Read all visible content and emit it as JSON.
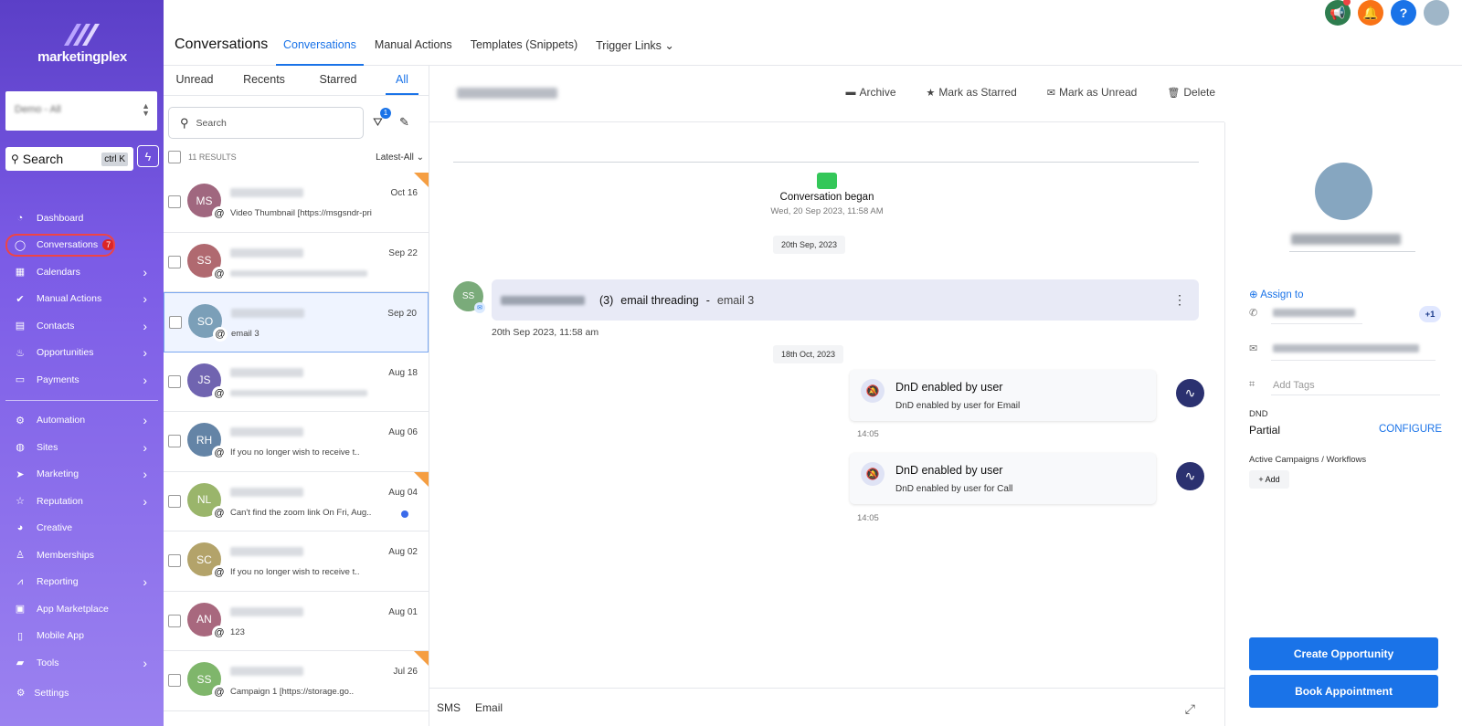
{
  "brand": {
    "name": "marketingplex"
  },
  "sidebar": {
    "account": "Demo - All",
    "search_label": "Search",
    "search_shortcut": "ctrl K",
    "items": [
      {
        "label": "Dashboard",
        "icon": "dashboard-icon",
        "arrow": false
      },
      {
        "label": "Conversations",
        "icon": "chat-icon",
        "arrow": false,
        "badge": "7",
        "active": true
      },
      {
        "label": "Calendars",
        "icon": "calendar-icon",
        "arrow": true
      },
      {
        "label": "Manual Actions",
        "icon": "check-circle-icon",
        "arrow": true
      },
      {
        "label": "Contacts",
        "icon": "contacts-icon",
        "arrow": true
      },
      {
        "label": "Opportunities",
        "icon": "flame-icon",
        "arrow": true
      },
      {
        "label": "Payments",
        "icon": "payments-icon",
        "arrow": true
      }
    ],
    "items2": [
      {
        "label": "Automation",
        "icon": "automation-icon",
        "arrow": true
      },
      {
        "label": "Sites",
        "icon": "globe-icon",
        "arrow": true
      },
      {
        "label": "Marketing",
        "icon": "send-icon",
        "arrow": true
      },
      {
        "label": "Reputation",
        "icon": "star-icon",
        "arrow": true
      },
      {
        "label": "Creative",
        "icon": "palette-icon",
        "arrow": false
      },
      {
        "label": "Memberships",
        "icon": "memberships-icon",
        "arrow": false
      },
      {
        "label": "Reporting",
        "icon": "chart-icon",
        "arrow": true
      },
      {
        "label": "App Marketplace",
        "icon": "grid-icon",
        "arrow": false
      },
      {
        "label": "Mobile App",
        "icon": "mobile-icon",
        "arrow": false
      },
      {
        "label": "Tools",
        "icon": "toolbox-icon",
        "arrow": true
      }
    ],
    "settings": "Settings"
  },
  "header": {
    "title": "Conversations",
    "tabs": [
      "Conversations",
      "Manual Actions",
      "Templates (Snippets)",
      "Trigger Links"
    ]
  },
  "list": {
    "tabs": [
      "Unread",
      "Recents",
      "Starred",
      "All"
    ],
    "search_placeholder": "Search",
    "filter_count": "1",
    "results": "11 RESULTS",
    "sort": "Latest-All",
    "conversations": [
      {
        "initials": "MS",
        "color": "#a0677f",
        "date": "Oct 16",
        "preview": "Video Thumbnail [https://msgsndr-pri",
        "starred": true
      },
      {
        "initials": "SS",
        "color": "#b06970",
        "date": "Sep 22",
        "preview": ""
      },
      {
        "initials": "SO",
        "color": "#7b9fb8",
        "date": "Sep 20",
        "preview": "email 3",
        "selected": true
      },
      {
        "initials": "JS",
        "color": "#7064b0",
        "date": "Aug 18",
        "preview": ""
      },
      {
        "initials": "RH",
        "color": "#6484a6",
        "date": "Aug 06",
        "preview": "If you no longer wish to receive t.."
      },
      {
        "initials": "NL",
        "color": "#9ab56b",
        "date": "Aug 04",
        "preview": "Can't find the zoom link On Fri, Aug..",
        "starred": true,
        "unread": true
      },
      {
        "initials": "SC",
        "color": "#b3a36a",
        "date": "Aug 02",
        "preview": "If you no longer wish to receive t.."
      },
      {
        "initials": "AN",
        "color": "#a8687e",
        "date": "Aug 01",
        "preview": "123"
      },
      {
        "initials": "SS",
        "color": "#7fb66b",
        "date": "Jul 26",
        "preview": "Campaign 1     [https://storage.go..",
        "starred": true
      }
    ]
  },
  "thread": {
    "actions": [
      "Archive",
      "Mark as Starred",
      "Mark as Unread",
      "Delete"
    ],
    "began_title": "Conversation began",
    "began_date": "Wed, 20 Sep 2023, 11:58 AM",
    "chip1": "20th Sep, 2023",
    "msg_avatar": "SS",
    "msg_count": "(3)",
    "msg_subject": "email threading",
    "msg_sep": "-",
    "msg_tail": "email 3",
    "msg_time": "20th Sep 2023, 11:58 am",
    "chip2": "18th Oct, 2023",
    "events": [
      {
        "title": "DnD enabled by user",
        "sub": "DnD enabled by user for Email",
        "time": "14:05"
      },
      {
        "title": "DnD enabled by user",
        "sub": "DnD enabled by user for Call",
        "time": "14:05"
      }
    ],
    "composer_tabs": [
      "SMS",
      "Email"
    ]
  },
  "details": {
    "assign": "Assign to",
    "extra_phones": "+1",
    "tags_placeholder": "Add Tags",
    "dnd_label": "DND",
    "dnd_value": "Partial",
    "configure": "CONFIGURE",
    "campaigns_label": "Active Campaigns / Workflows",
    "add": "Add",
    "create_opportunity": "Create Opportunity",
    "book_appointment": "Book Appointment"
  }
}
